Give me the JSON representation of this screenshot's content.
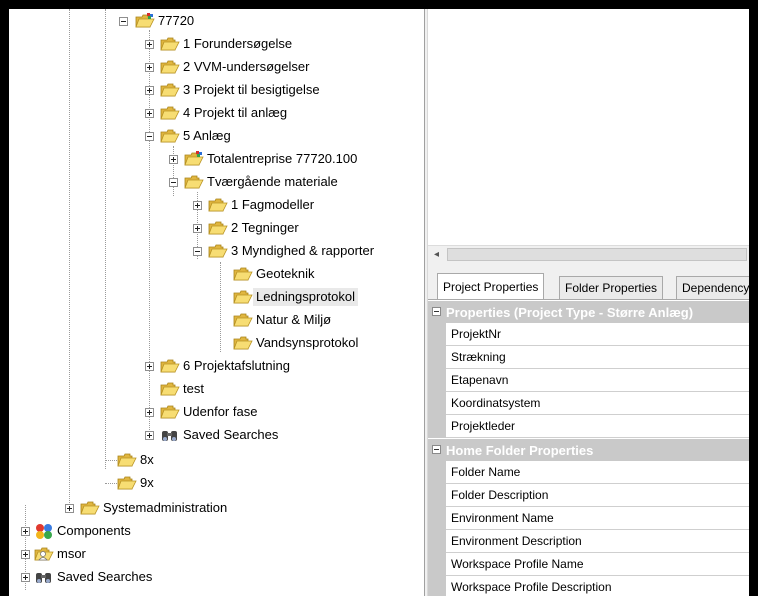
{
  "tree": {
    "nodes": [
      {
        "label": "77720",
        "icon": "project-folder-icon"
      },
      {
        "label": "1 Forundersøgelse",
        "icon": "folder-icon"
      },
      {
        "label": "2 VVM-undersøgelser",
        "icon": "folder-icon"
      },
      {
        "label": "3 Projekt til besigtigelse",
        "icon": "folder-icon"
      },
      {
        "label": "4 Projekt til anlæg",
        "icon": "folder-icon"
      },
      {
        "label": "5 Anlæg",
        "icon": "folder-icon"
      },
      {
        "label": "Totalentreprise 77720.100",
        "icon": "project-folder-icon"
      },
      {
        "label": "Tværgående materiale",
        "icon": "folder-icon"
      },
      {
        "label": "1 Fagmodeller",
        "icon": "folder-icon"
      },
      {
        "label": "2 Tegninger",
        "icon": "folder-icon"
      },
      {
        "label": "3 Myndighed & rapporter",
        "icon": "folder-icon"
      },
      {
        "label": "Geoteknik",
        "icon": "folder-icon"
      },
      {
        "label": "Ledningsprotokol",
        "icon": "folder-icon"
      },
      {
        "label": "Natur & Miljø",
        "icon": "folder-icon"
      },
      {
        "label": "Vandsynsprotokol",
        "icon": "folder-icon"
      },
      {
        "label": "6 Projektafslutning",
        "icon": "folder-icon"
      },
      {
        "label": "test",
        "icon": "folder-icon"
      },
      {
        "label": "Udenfor fase",
        "icon": "folder-icon"
      },
      {
        "label": "Saved Searches",
        "icon": "binoculars-icon"
      },
      {
        "label": "8x",
        "icon": "folder-icon"
      },
      {
        "label": "9x",
        "icon": "folder-icon"
      },
      {
        "label": "Systemadministration",
        "icon": "folder-icon"
      },
      {
        "label": "Components",
        "icon": "components-icon"
      },
      {
        "label": "msor",
        "icon": "user-folder-icon"
      },
      {
        "label": "Saved Searches",
        "icon": "binoculars-icon"
      }
    ],
    "selected": "Ledningsprotokol"
  },
  "scrollbar": {
    "left_arrow": "◂"
  },
  "tabs": [
    {
      "label": "Project Properties",
      "active": true
    },
    {
      "label": "Folder Properties",
      "active": false
    },
    {
      "label": "Dependency",
      "active": false
    }
  ],
  "grid": {
    "categories": [
      {
        "title": "Properties (Project Type - Større Anlæg)",
        "rows": [
          "ProjektNr",
          "Strækning",
          "Etapenavn",
          "Koordinatsystem",
          "Projektleder"
        ]
      },
      {
        "title": "Home Folder Properties",
        "rows": [
          "Folder Name",
          "Folder Description",
          "Environment Name",
          "Environment Description",
          "Workspace Profile Name",
          "Workspace Profile Description"
        ]
      }
    ]
  },
  "colors": {
    "folder": "#f2d45c",
    "folder_dark": "#c9a227",
    "category": "#c9c9c9",
    "selection": "#e9e9e9"
  }
}
